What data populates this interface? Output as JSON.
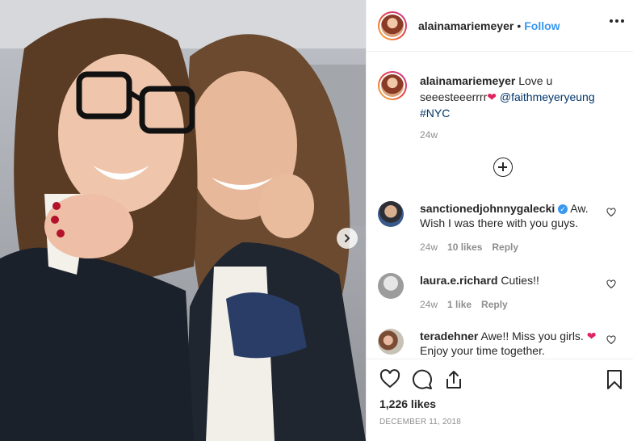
{
  "post": {
    "username": "alainamariemeyer",
    "separator": "•",
    "follow_label": "Follow"
  },
  "caption": {
    "username": "alainamariemeyer",
    "text": "Love u seeesteeerrrr",
    "emoji": "❤",
    "mention": "@faithmeyeryeung",
    "hashtag": "#NYC",
    "age": "24w"
  },
  "comments": [
    {
      "username": "sanctionedjohnnygalecki",
      "verified": "✓",
      "text": "Aw. Wish I was there with you guys.",
      "age": "24w",
      "likes": "10 likes",
      "reply_label": "Reply"
    },
    {
      "username": "laura.e.richard",
      "text": "Cuties!!",
      "age": "24w",
      "likes": "1 like",
      "reply_label": "Reply"
    },
    {
      "username": "teradehner",
      "text": "Awe!! Miss you girls.",
      "emoji": "❤",
      "text2": "Enjoy your time together."
    }
  ],
  "footer": {
    "likes": "1,226 likes",
    "date": "DECEMBER 11, 2018"
  },
  "icons": {
    "like": "heart-icon",
    "comment": "comment-bubble-icon",
    "share": "share-icon",
    "save": "bookmark-icon",
    "next": "chevron-right-icon",
    "more": "more-options-icon",
    "load_more": "plus-circle-icon"
  },
  "colors": {
    "accent": "#3897f0",
    "muted": "#8e8e8e",
    "link": "#003569",
    "heart": "#e0245e"
  }
}
